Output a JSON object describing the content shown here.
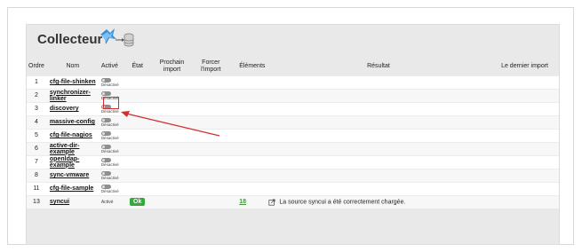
{
  "panel": {
    "title": "Collecteur"
  },
  "columns": {
    "ordre": "Ordre",
    "nom": "Nom",
    "active": "Activé",
    "etat": "État",
    "prochain": "Prochain import",
    "forcer": "Forcer l'import",
    "elements": "Éléments",
    "resultat": "Résultat",
    "dernier": "Le dernier import"
  },
  "rows": [
    {
      "ordre": "1",
      "nom": "cfg-file-shinken",
      "status": "Désactivé"
    },
    {
      "ordre": "2",
      "nom": "synchronizer-linker",
      "status": "Désactivé"
    },
    {
      "ordre": "3",
      "nom": "discovery",
      "status": "Désactivé"
    },
    {
      "ordre": "4",
      "nom": "massive-config",
      "status": "Désactivé"
    },
    {
      "ordre": "5",
      "nom": "cfg-file-nagios",
      "status": "Désactivé"
    },
    {
      "ordre": "6",
      "nom": "active-dir-example",
      "status": "Désactivé"
    },
    {
      "ordre": "7",
      "nom": "openldap-example",
      "status": "Désactivé"
    },
    {
      "ordre": "8",
      "nom": "sync-vmware",
      "status": "Désactivé"
    },
    {
      "ordre": "11",
      "nom": "cfg-file-sample",
      "status": "Désactivé"
    },
    {
      "ordre": "13",
      "nom": "syncui",
      "status": "Activé",
      "etat": "Ok",
      "elements": "18",
      "resultat": "La source syncui a été correctement chargée."
    }
  ],
  "colors": {
    "panel_bg": "#e9e9e9",
    "ok_green": "#36a93b",
    "highlight_red": "#d23030"
  }
}
